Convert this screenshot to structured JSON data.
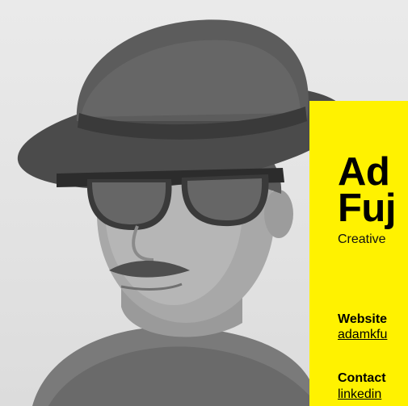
{
  "profile": {
    "name_line1": "Ad",
    "name_line2": "Fuj",
    "role": "Creative",
    "website_label": "Website",
    "website_value": "adamkfu",
    "contact_label": "Contact",
    "contact_value": "linkedin"
  },
  "colors": {
    "card_background": "#fff200",
    "text": "#000000"
  }
}
